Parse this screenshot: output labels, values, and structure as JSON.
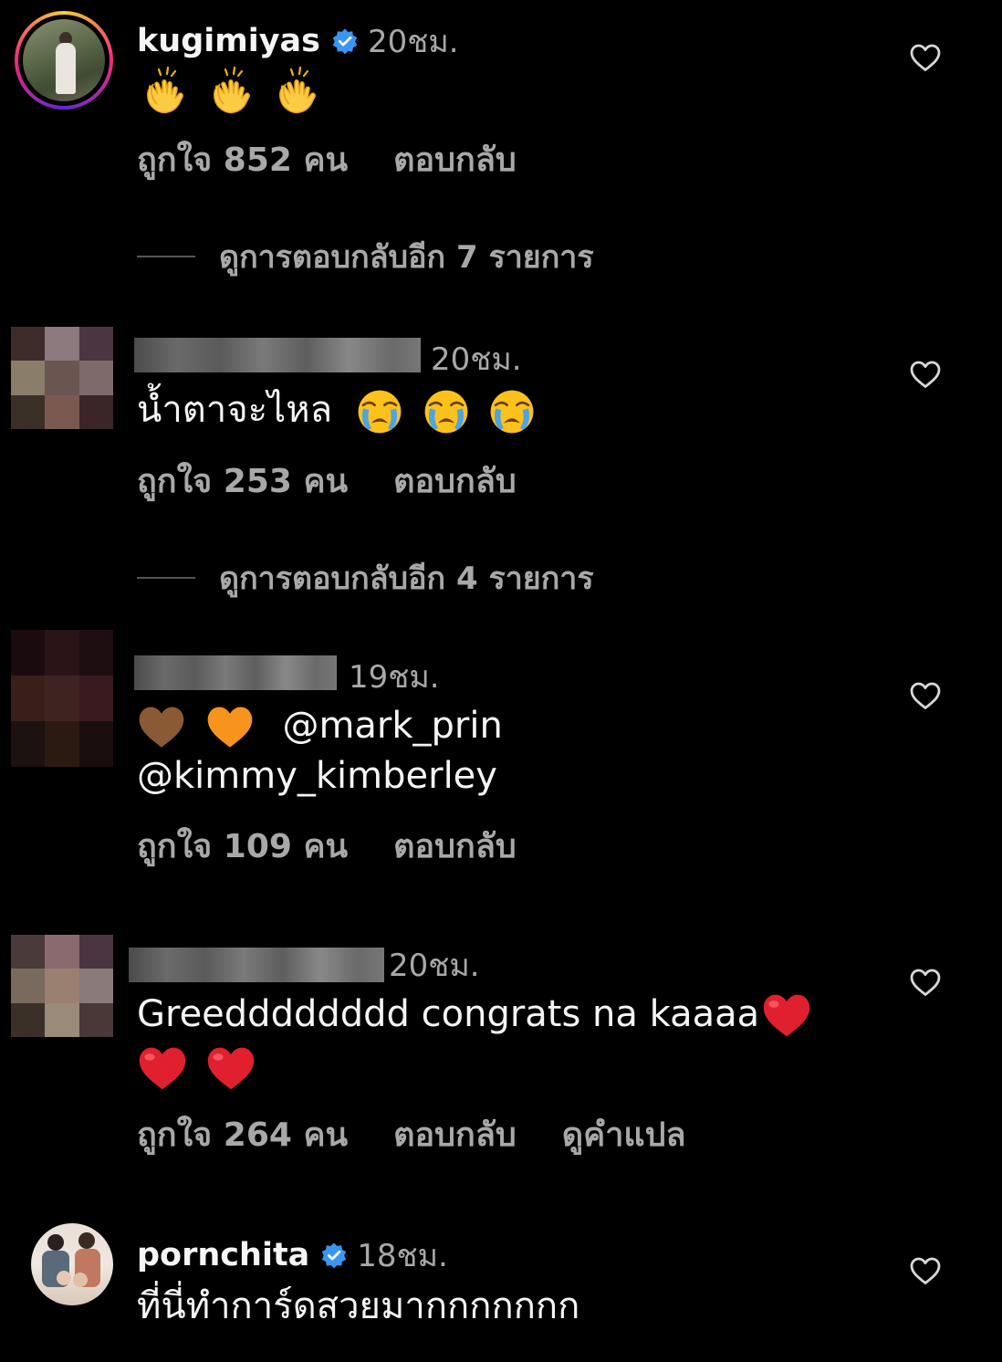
{
  "comments": [
    {
      "username": "kugimiyas",
      "verified": true,
      "time": "20ชม.",
      "likes": "ถูกใจ 852 คน",
      "reply_label": "ตอบกลับ",
      "view_replies": "ดูการตอบกลับอีก 7 รายการ",
      "emoji": "clapping-hands x3"
    },
    {
      "username_redacted": true,
      "time": "20ชม.",
      "text": "น้ำตาจะไหล",
      "emoji": "loudly-crying-face x3",
      "likes": "ถูกใจ 253 คน",
      "reply_label": "ตอบกลับ",
      "view_replies": "ดูการตอบกลับอีก 4 รายการ"
    },
    {
      "username_redacted": true,
      "time": "19ชม.",
      "mention1": "@mark_prin",
      "mention2": "@kimmy_kimberley",
      "emoji": "brown-heart, orange-heart",
      "likes": "ถูกใจ 109 คน",
      "reply_label": "ตอบกลับ"
    },
    {
      "username_redacted": true,
      "time": "20ชม.",
      "text": "Greedddddddd congrats na kaaaa",
      "emoji": "red-heart x3",
      "likes": "ถูกใจ 264 คน",
      "reply_label": "ตอบกลับ",
      "translate_label": "ดูคำแปล"
    },
    {
      "username": "pornchita",
      "verified": true,
      "time": "18ชม.",
      "text": "ที่นี่ทำการ์ดสวยมากกกกกกก"
    }
  ],
  "colors": {
    "background": "#000000",
    "primary_text": "#f5f5f5",
    "secondary_text": "#a8a8a8",
    "verified_badge": "#3897f0"
  }
}
